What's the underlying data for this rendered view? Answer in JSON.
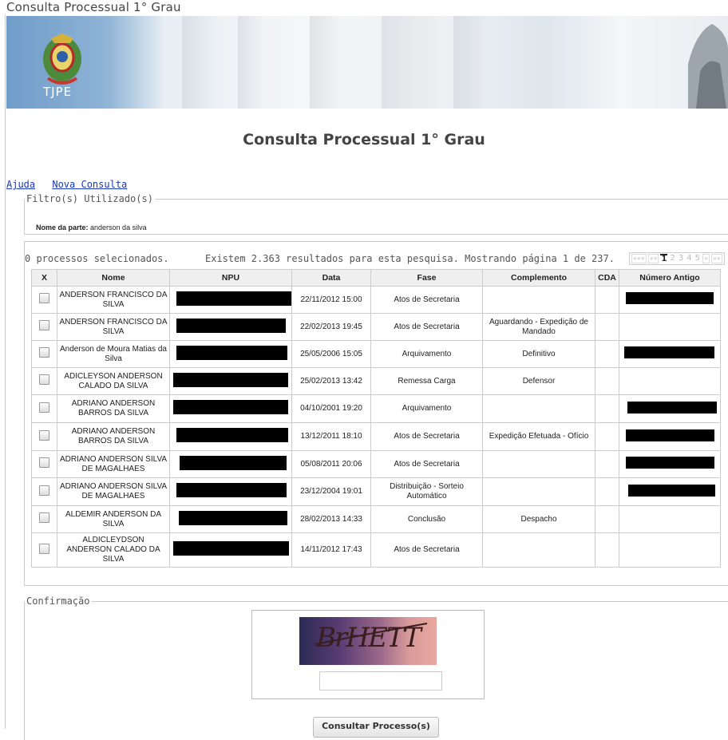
{
  "header": {
    "top_title": "Consulta Processual 1° Grau",
    "logo_text": "TJPE"
  },
  "page_title": "Consulta Processual 1° Grau",
  "links": {
    "help": "Ajuda",
    "new_search": "Nova Consulta"
  },
  "filter": {
    "legend": "Filtro(s) Utilizado(s)",
    "label": "Nome da parte:",
    "value": "anderson da silva"
  },
  "results": {
    "selected_text": "0 processos selecionados.",
    "summary_text": "Existem 2.363 resultados para esta pesquisa. Mostrando página 1 de 237.",
    "pager": {
      "first": "«««",
      "prev": "««",
      "pages": [
        "1",
        "2",
        "3",
        "4",
        "5"
      ],
      "current": "1",
      "next": "»",
      "last": "»»"
    },
    "columns": [
      "X",
      "Nome",
      "NPU",
      "Data",
      "Fase",
      "Complemento",
      "CDA",
      "Número Antigo"
    ],
    "rows": [
      {
        "nome": "ANDERSON FRANCISCO DA SILVA",
        "data": "22/11/2012 15:00",
        "fase": "Atos de Secretaria",
        "complemento": "",
        "cda": "",
        "npu_redacted": true,
        "antigo_redacted": true
      },
      {
        "nome": "ANDERSON FRANCISCO DA SILVA",
        "data": "22/02/2013 19:45",
        "fase": "Atos de Secretaria",
        "complemento": "Aguardando - Expedição de Mandado",
        "cda": "",
        "npu_redacted": true,
        "antigo_redacted": false
      },
      {
        "nome": "Anderson de Moura Matias da Silva",
        "data": "25/05/2006 15:05",
        "fase": "Arquivamento",
        "complemento": "Definitivo",
        "cda": "",
        "npu_redacted": true,
        "antigo_redacted": true
      },
      {
        "nome": "ADICLEYSON ANDERSON CALADO DA SILVA",
        "data": "25/02/2013 13:42",
        "fase": "Remessa Carga",
        "complemento": "Defensor",
        "cda": "",
        "npu_redacted": true,
        "antigo_redacted": false
      },
      {
        "nome": "ADRIANO ANDERSON BARROS DA SILVA",
        "data": "04/10/2001 19:20",
        "fase": "Arquivamento",
        "complemento": "",
        "cda": "",
        "npu_redacted": true,
        "antigo_redacted": true
      },
      {
        "nome": "ADRIANO ANDERSON BARROS DA SILVA",
        "data": "13/12/2011 18:10",
        "fase": "Atos de Secretaria",
        "complemento": "Expedição Efetuada - Ofício",
        "cda": "",
        "npu_redacted": true,
        "antigo_redacted": true
      },
      {
        "nome": "ADRIANO ANDERSON SILVA DE MAGALHAES",
        "data": "05/08/2011 20:06",
        "fase": "Atos de Secretaria",
        "complemento": "",
        "cda": "",
        "npu_redacted": true,
        "antigo_redacted": true
      },
      {
        "nome": "ADRIANO ANDERSON SILVA DE MAGALHAES",
        "data": "23/12/2004 19:01",
        "fase": "Distribuição - Sorteio Automático",
        "complemento": "",
        "cda": "",
        "npu_redacted": true,
        "antigo_redacted": true
      },
      {
        "nome": "ALDEMIR ANDERSON DA SILVA",
        "data": "28/02/2013 14:33",
        "fase": "Conclusão",
        "complemento": "Despacho",
        "cda": "",
        "npu_redacted": true,
        "antigo_redacted": false
      },
      {
        "nome": "ALDICLEYDSON ANDERSON CALADO DA SILVA",
        "data": "14/11/2012 17:43",
        "fase": "Atos de Secretaria",
        "complemento": "",
        "cda": "",
        "npu_redacted": true,
        "antigo_redacted": false
      }
    ]
  },
  "confirm": {
    "legend": "Confirmação",
    "captcha_text": "BrHETT",
    "captcha_value": "",
    "submit_label": "Consultar Processo(s)"
  }
}
